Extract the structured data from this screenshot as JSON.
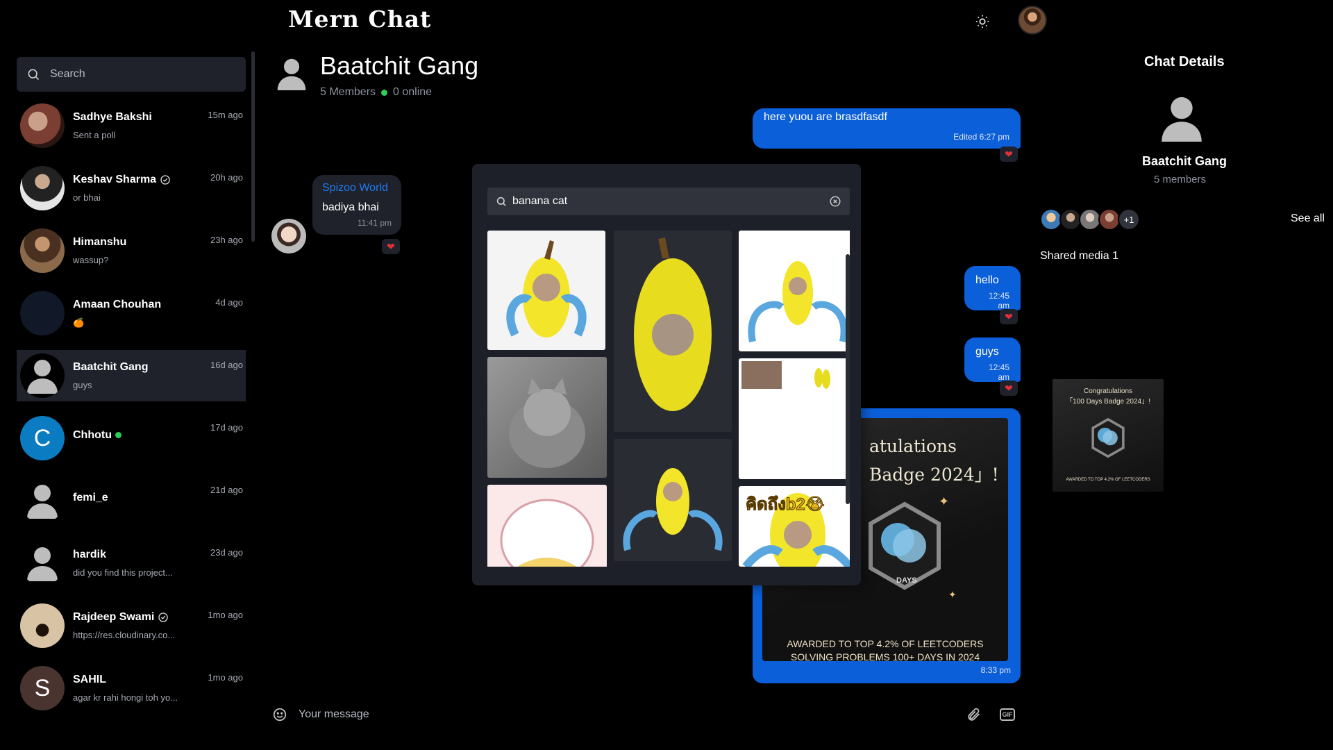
{
  "app": {
    "title": "Mern Chat"
  },
  "sidebar": {
    "search_placeholder": "Search",
    "chats": [
      {
        "name": "Sadhye Bakshi",
        "last": "Sent a poll",
        "time": "15m ago"
      },
      {
        "name": "Keshav Sharma",
        "last": "or bhai",
        "time": "20h ago",
        "verified": true
      },
      {
        "name": "Himanshu",
        "last": "wassup?",
        "time": "23h ago"
      },
      {
        "name": "Amaan Chouhan",
        "last": "🍊",
        "time": "4d ago"
      },
      {
        "name": "Baatchit Gang",
        "last": "guys",
        "time": "16d ago",
        "active": true
      },
      {
        "name": "Chhotu",
        "last": "",
        "time": "17d ago",
        "initial": "C",
        "online": true
      },
      {
        "name": "femi_e",
        "last": "",
        "time": "21d ago"
      },
      {
        "name": "hardik",
        "last": "did you find this project...",
        "time": "23d ago"
      },
      {
        "name": "Rajdeep Swami",
        "last": "https://res.cloudinary.co...",
        "time": "1mo ago",
        "verified": true
      },
      {
        "name": "SAHIL",
        "last": "agar kr rahi hongi toh yo...",
        "time": "1mo ago",
        "initial": "S"
      }
    ]
  },
  "chat": {
    "title": "Baatchit Gang",
    "members_text": "5 Members",
    "online_text": "0 online",
    "messages": {
      "m1_text": "here yuou are brasdfasdf",
      "m1_edited": "Edited",
      "m1_time": "6:27 pm",
      "m2_sender": "Spizoo World",
      "m2_text": "badiya bhai",
      "m2_time": "11:41 pm",
      "m3_text": "hello",
      "m3_time": "12:45 am",
      "m4_text": "guys",
      "m4_time": "12:45 am",
      "m5_time": "8:33 pm",
      "m5_image_line1": "atulations",
      "m5_image_line2": "Badge 2024」!",
      "m5_image_award": "AWARDED TO TOP 4.2% OF LEETCODERS",
      "m5_image_award2": "SOLVING PROBLEMS 100+ DAYS IN 2024",
      "m5_image_days": "DAYS"
    },
    "composer_placeholder": "Your message",
    "gif_label": "GIF"
  },
  "gif_picker": {
    "query": "banana cat",
    "tile6_text": "คิดถึงb2😭"
  },
  "details": {
    "title": "Chat Details",
    "name": "Baatchit Gang",
    "count": "5 members",
    "more_members": "+1",
    "see_all": "See all",
    "shared_media": "Shared media 1",
    "thumb_line1": "Congratulations",
    "thumb_line2": "「100 Days Badge 2024」!",
    "thumb_line3": "AWARDED TO TOP 4.2% OF LEETCODERS"
  },
  "colors": {
    "accent": "#0b5fd9",
    "panel": "#1f222b",
    "online": "#2ecc5a",
    "heart": "#e0303a"
  }
}
